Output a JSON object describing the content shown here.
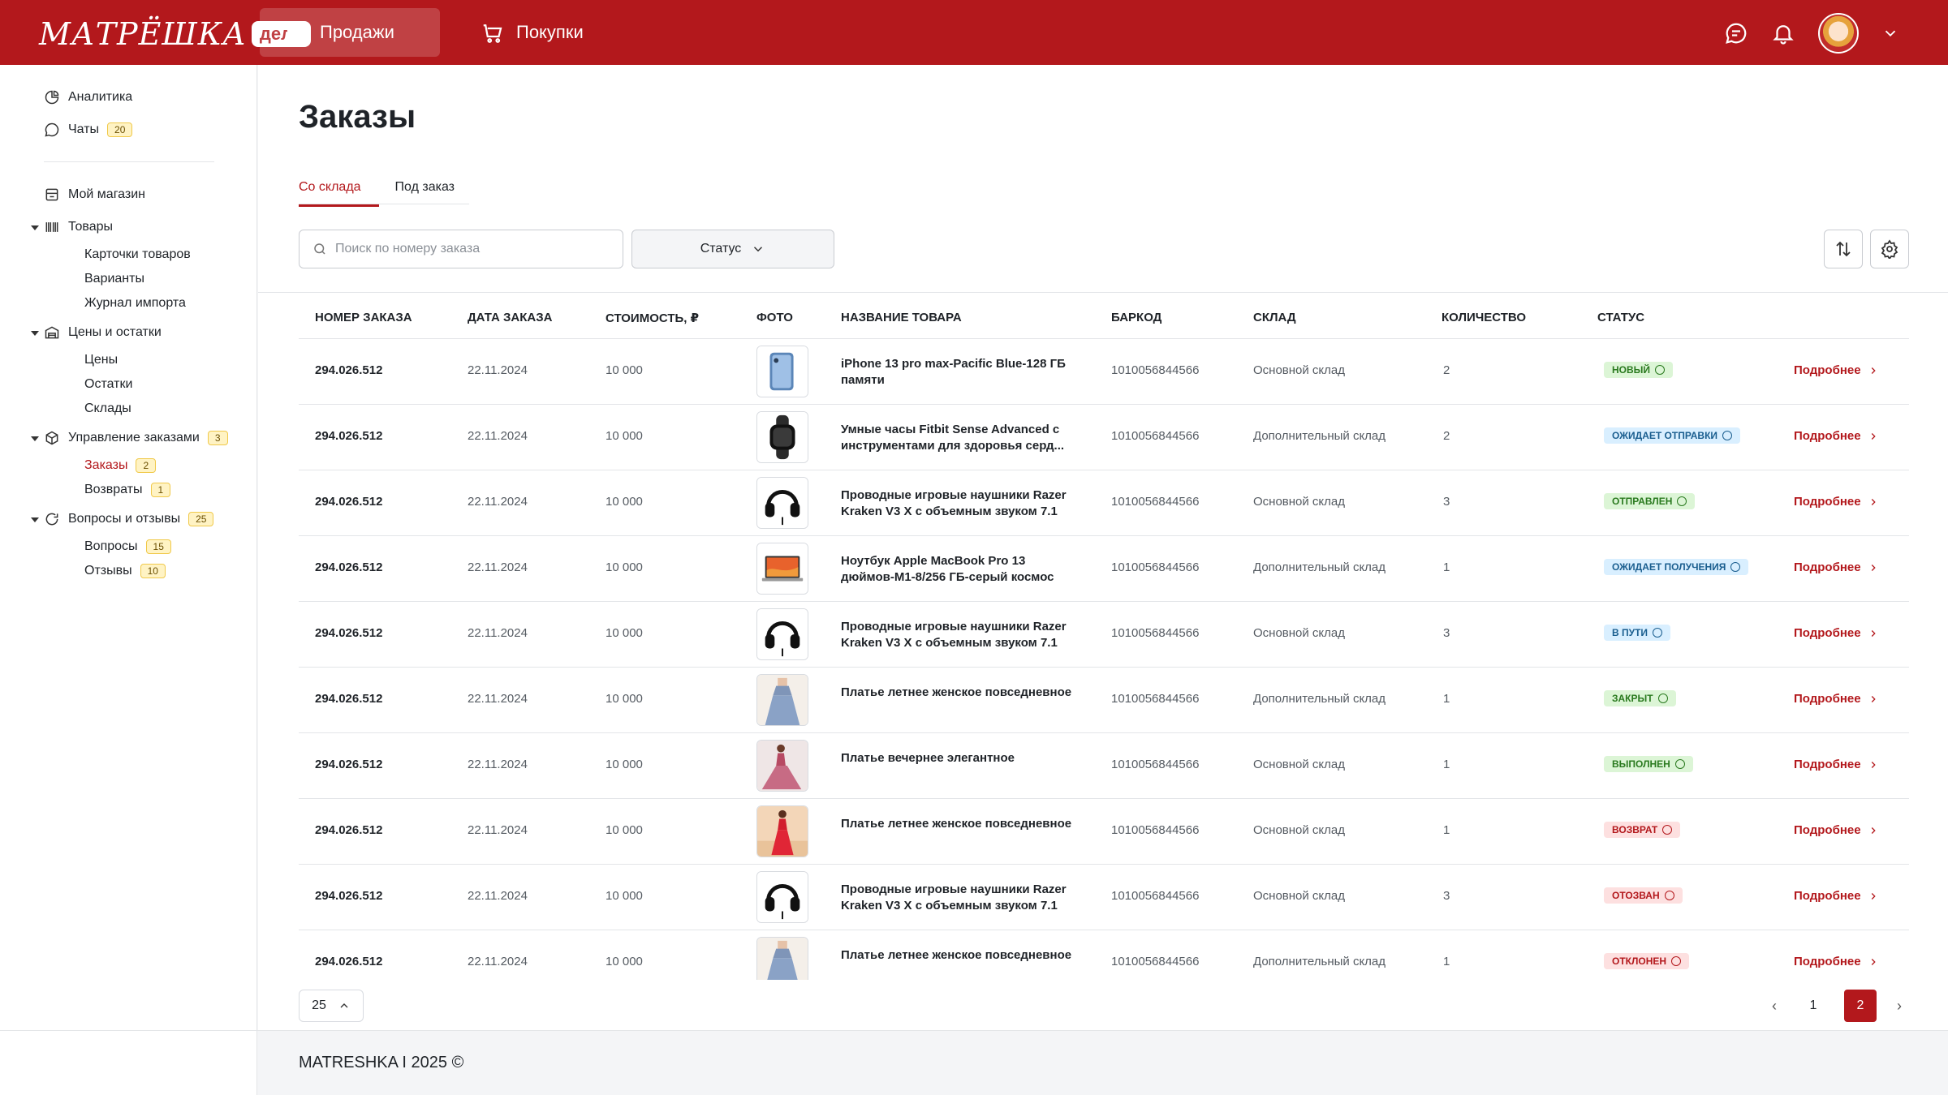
{
  "header": {
    "logo_text": "МАТРЁШКА",
    "logo_badge": "дело",
    "tabs": [
      {
        "label": "Продажи",
        "active": true
      },
      {
        "label": "Покупки",
        "active": false
      }
    ]
  },
  "sidebar": {
    "analytics": "Аналитика",
    "chats": {
      "label": "Чаты",
      "badge": "20"
    },
    "my_shop": "Мой магазин",
    "goods": {
      "label": "Товары",
      "children": [
        "Карточки товаров",
        "Варианты",
        "Журнал импорта"
      ]
    },
    "prices": {
      "label": "Цены и остатки",
      "children": [
        "Цены",
        "Остатки",
        "Склады"
      ]
    },
    "orders_mgmt": {
      "label": "Управление заказами",
      "badge": "3",
      "children": [
        {
          "label": "Заказы",
          "badge": "2"
        },
        {
          "label": "Возвраты",
          "badge": "1"
        }
      ]
    },
    "questions": {
      "label": "Вопросы и отзывы",
      "badge": "25",
      "children": [
        {
          "label": "Вопросы",
          "badge": "15"
        },
        {
          "label": "Отзывы",
          "badge": "10"
        }
      ]
    }
  },
  "page": {
    "title": "Заказы",
    "subtabs": [
      "Со склада",
      "Под заказ"
    ],
    "search_placeholder": "Поиск по номеру заказа",
    "status_filter": "Статус"
  },
  "table": {
    "columns": [
      "НОМЕР ЗАКАЗА",
      "ДАТА ЗАКАЗА",
      "СТОИМОСТЬ, ₽",
      "ФОТО",
      "НАЗВАНИЕ ТОВАРА",
      "БАРКОД",
      "СКЛАД",
      "КОЛИЧЕСТВО",
      "СТАТУС"
    ],
    "more_label": "Подробнее",
    "rows": [
      {
        "number": "294.026.512",
        "date": "22.11.2024",
        "price": "10 000",
        "photo": "phone-photo",
        "name": "iPhone 13 pro max-Pacific Blue-128 ГБ памяти",
        "barcode": "1010056844566",
        "warehouse": "Основной склад",
        "qty": "2",
        "status": "НОВЫЙ",
        "status_bg": "#dcf5d6",
        "status_fg": "#2a7a1f"
      },
      {
        "number": "294.026.512",
        "date": "22.11.2024",
        "price": "10 000",
        "photo": "watch-photo",
        "name": "Умные часы Fitbit Sense Advanced с инструментами для здоровья серд...",
        "barcode": "1010056844566",
        "warehouse": "Дополнительный склад",
        "qty": "2",
        "status": "ОЖИДАЕТ ОТПРАВКИ",
        "status_bg": "#d9efff",
        "status_fg": "#1a5e8f"
      },
      {
        "number": "294.026.512",
        "date": "22.11.2024",
        "price": "10 000",
        "photo": "headphones-photo",
        "name": "Проводные игровые наушники Razer Kraken V3 X с объемным звуком 7.1",
        "barcode": "1010056844566",
        "warehouse": "Основной склад",
        "qty": "3",
        "status": "ОТПРАВЛЕН",
        "status_bg": "#dcf5d6",
        "status_fg": "#2a7a1f"
      },
      {
        "number": "294.026.512",
        "date": "22.11.2024",
        "price": "10 000",
        "photo": "laptop-photo",
        "name": "Ноутбук Apple MacBook Pro 13 дюймов-M1-8/256 ГБ-серый космос",
        "barcode": "1010056844566",
        "warehouse": "Дополнительный склад",
        "qty": "1",
        "status": "ОЖИДАЕТ ПОЛУЧЕНИЯ",
        "status_bg": "#d9efff",
        "status_fg": "#1a5e8f"
      },
      {
        "number": "294.026.512",
        "date": "22.11.2024",
        "price": "10 000",
        "photo": "headphones-photo",
        "name": "Проводные игровые наушники Razer Kraken V3 X с объемным звуком 7.1",
        "barcode": "1010056844566",
        "warehouse": "Основной склад",
        "qty": "3",
        "status": "В ПУТИ",
        "status_bg": "#d9efff",
        "status_fg": "#1a5e8f"
      },
      {
        "number": "294.026.512",
        "date": "22.11.2024",
        "price": "10 000",
        "photo": "dress-blue-photo",
        "name": "Платье летнее женское повседневное",
        "barcode": "1010056844566",
        "warehouse": "Дополнительный склад",
        "qty": "1",
        "status": "ЗАКРЫТ",
        "status_bg": "#dcf5d6",
        "status_fg": "#2a7a1f"
      },
      {
        "number": "294.026.512",
        "date": "22.11.2024",
        "price": "10 000",
        "photo": "dress-evening-photo",
        "name": "Платье вечернее элегантное",
        "barcode": "1010056844566",
        "warehouse": "Основной склад",
        "qty": "1",
        "status": "ВЫПОЛНЕН",
        "status_bg": "#dcf5d6",
        "status_fg": "#2a7a1f"
      },
      {
        "number": "294.026.512",
        "date": "22.11.2024",
        "price": "10 000",
        "photo": "dress-red-photo",
        "name": "Платье летнее женское повседневное",
        "barcode": "1010056844566",
        "warehouse": "Основной склад",
        "qty": "1",
        "status": "ВОЗВРАТ",
        "status_bg": "#fde0e0",
        "status_fg": "#b3181c"
      },
      {
        "number": "294.026.512",
        "date": "22.11.2024",
        "price": "10 000",
        "photo": "headphones-photo",
        "name": "Проводные игровые наушники Razer Kraken V3 X с объемным звуком 7.1",
        "barcode": "1010056844566",
        "warehouse": "Основной склад",
        "qty": "3",
        "status": "ОТОЗВАН",
        "status_bg": "#fde0e0",
        "status_fg": "#b3181c"
      },
      {
        "number": "294.026.512",
        "date": "22.11.2024",
        "price": "10 000",
        "photo": "dress-blue-photo",
        "name": "Платье летнее женское повседневное",
        "barcode": "1010056844566",
        "warehouse": "Дополнительный склад",
        "qty": "1",
        "status": "ОТКЛОНЕН",
        "status_bg": "#fde0e0",
        "status_fg": "#b3181c"
      }
    ]
  },
  "pagination": {
    "per_page": "25",
    "pages": [
      "1",
      "2"
    ],
    "current": "2"
  },
  "footer": {
    "text": "MATRESHKA I 2025 ©"
  }
}
